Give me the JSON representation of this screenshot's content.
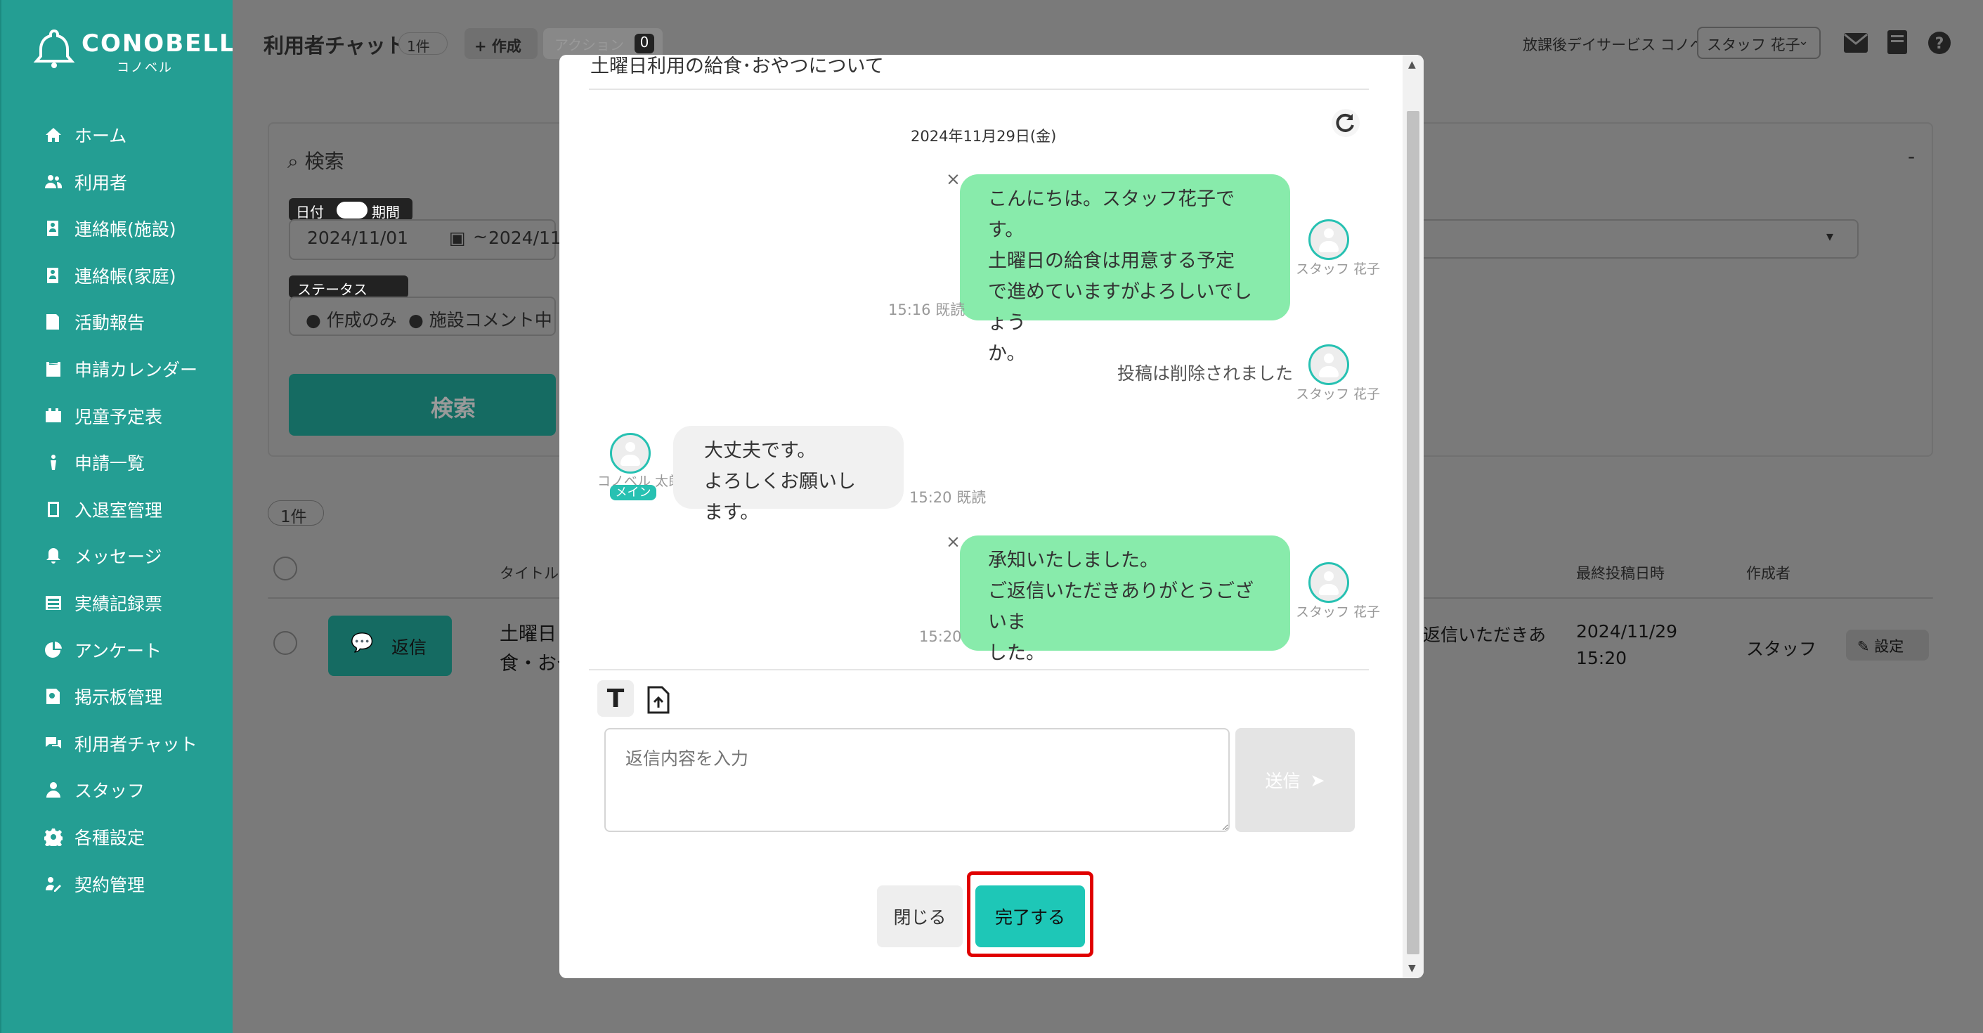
{
  "colors": {
    "accent": "#249e93",
    "bubble_self": "#88ebab",
    "bubble_other": "#f1f1f1",
    "highlight": "#e00000",
    "complete_btn": "#1ec7b7"
  },
  "logo": {
    "name": "CONOBELL",
    "kana": "コノベル"
  },
  "sidebar": {
    "items": [
      {
        "label": "ホーム",
        "icon": "home-icon"
      },
      {
        "label": "利用者",
        "icon": "users-icon"
      },
      {
        "label": "連絡帳(施設)",
        "icon": "contact-book-icon"
      },
      {
        "label": "連絡帳(家庭)",
        "icon": "contact-book-icon"
      },
      {
        "label": "活動報告",
        "icon": "report-icon"
      },
      {
        "label": "申請カレンダー",
        "icon": "calendar-icon"
      },
      {
        "label": "児童予定表",
        "icon": "schedule-icon"
      },
      {
        "label": "申請一覧",
        "icon": "request-list-icon"
      },
      {
        "label": "入退室管理",
        "icon": "entry-exit-icon"
      },
      {
        "label": "メッセージ",
        "icon": "bell-icon"
      },
      {
        "label": "実績記録票",
        "icon": "record-icon"
      },
      {
        "label": "アンケート",
        "icon": "survey-icon"
      },
      {
        "label": "掲示板管理",
        "icon": "board-icon"
      },
      {
        "label": "利用者チャット",
        "icon": "chat-icon"
      },
      {
        "label": "スタッフ",
        "icon": "staff-icon"
      },
      {
        "label": "各種設定",
        "icon": "gear-icon"
      },
      {
        "label": "契約管理",
        "icon": "contract-icon"
      }
    ]
  },
  "header": {
    "title": "利用者チャット",
    "count_badge": "1件",
    "create_label": "作成",
    "action_label": "アクション",
    "action_count": "0",
    "facility": "放課後デイサービス コノベル",
    "user_select": "スタッフ 花子"
  },
  "search": {
    "title": "検索",
    "collapse": "-",
    "date_label": "日付",
    "period_label": "期間",
    "date_from": "2024/11/01",
    "range_sep": "~",
    "date_to": "2024/11/",
    "status_label": "ステータス",
    "status_opts": [
      "作成のみ",
      "施設コメント中"
    ],
    "button": "検索"
  },
  "list": {
    "count": "1件",
    "headers": {
      "title": "タイトル",
      "last_post": "最終投稿日時",
      "author": "作成者"
    },
    "row": {
      "reply": "返信",
      "title_part1": "土曜日",
      "title_part2": "食・おや",
      "preview": "返信いただきあ",
      "date": "2024/11/29",
      "time": "15:20",
      "author": "スタッフ",
      "settings": "設定"
    }
  },
  "modal": {
    "title": "土曜日利用の給食･おやつについて",
    "date_header": "2024年11月29日(金)",
    "messages": [
      {
        "side": "right",
        "lines": [
          "こんにちは。スタッフ花子です。",
          "土曜日の給食は用意する予定",
          "で進めていますがよろしいでしょう",
          "か。"
        ],
        "time": "15:16 既読",
        "sender": "スタッフ 花子",
        "delete": "×"
      },
      {
        "side": "right",
        "deleted": "投稿は削除されました",
        "sender": "スタッフ 花子"
      },
      {
        "side": "left",
        "lines": [
          "大丈夫です。",
          "よろしくお願いします。"
        ],
        "time": "15:20 既読",
        "sender": "コノベル 太郎",
        "badge": "メイン"
      },
      {
        "side": "right",
        "lines": [
          "承知いたしました。",
          "ご返信いただきありがとうございま",
          "した。"
        ],
        "time": "15:20",
        "sender": "スタッフ 花子",
        "delete": "×"
      }
    ],
    "reply_placeholder": "返信内容を入力",
    "send_label": "送信",
    "close_label": "閉じる",
    "complete_label": "完了する"
  }
}
